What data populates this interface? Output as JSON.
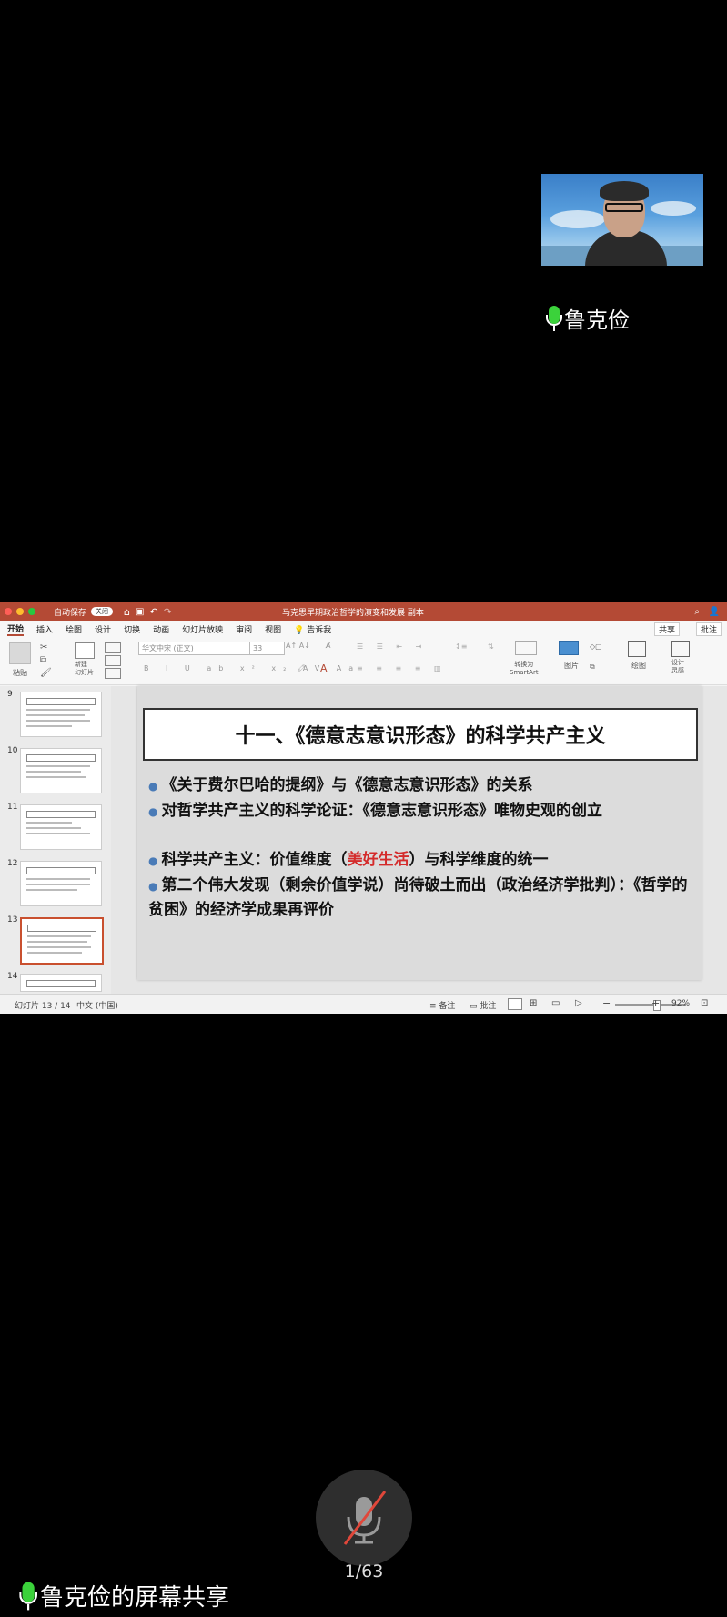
{
  "participant": {
    "name": "鲁克俭"
  },
  "screen_share": {
    "owner_label": "鲁克俭的屏幕共享",
    "page_indicator": "1/63"
  },
  "ppt": {
    "window_title": "马克思早期政治哲学的演变和发展 副本",
    "autosave_label": "自动保存",
    "autosave_state": "关闭",
    "menu_tabs": [
      "开始",
      "插入",
      "绘图",
      "设计",
      "切换",
      "动画",
      "幻灯片放映",
      "审阅",
      "视图"
    ],
    "tell_me": "告诉我",
    "share_button": "共享",
    "comment_button": "批注",
    "ribbon": {
      "paste": "粘贴",
      "new_slide": "新建\n幻灯片",
      "font_name": "华文中宋 (正文)",
      "font_size": "33",
      "convert_smartart": "转换为\nSmartArt",
      "picture": "图片",
      "drawing": "绘图",
      "design_ideas": "设计\n灵感"
    },
    "thumbnails": [
      "9",
      "10",
      "11",
      "12",
      "13",
      "14"
    ],
    "selected_thumbnail": "13",
    "slide": {
      "title": "十一、《德意志意识形态》的科学共产主义",
      "bullets": [
        {
          "before": "《关于费尔巴哈的提纲》与《德意志意识形态》的关系",
          "highlight": "",
          "after": ""
        },
        {
          "before": "对哲学共产主义的科学论证：《德意志意识形态》唯物史观的创立",
          "highlight": "",
          "after": ""
        },
        {
          "before": "科学共产主义：价值维度（",
          "highlight": "美好生活",
          "after": "）与科学维度的统一"
        },
        {
          "before": "第二个伟大发现（剩余价值学说）尚待破土而出（政治经济学批判）：《哲学的贫困》的经济学成果再评价",
          "highlight": "",
          "after": ""
        }
      ]
    },
    "status": {
      "slide_counter": "幻灯片 13 / 14",
      "language": "中文 (中国)",
      "notes": "备注",
      "comments": "批注",
      "zoom": "92%"
    }
  },
  "colors": {
    "accent": "#b44a35",
    "mic_green": "#3bd23b",
    "highlight_red": "#d42b2b"
  }
}
